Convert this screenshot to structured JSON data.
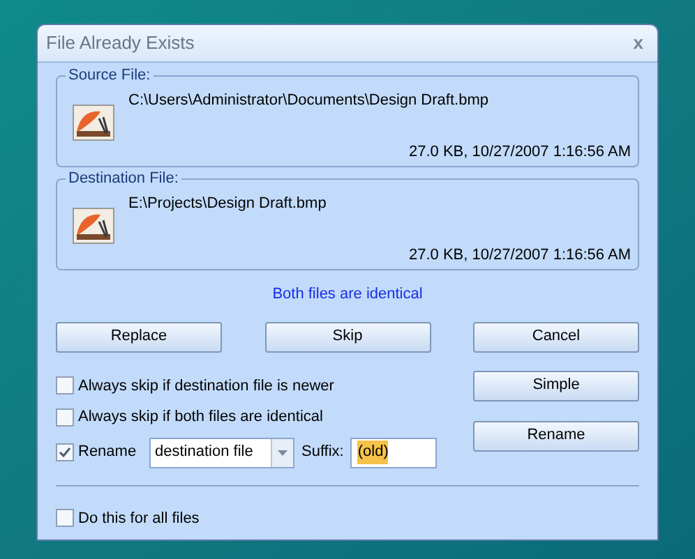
{
  "window": {
    "title": "File Already Exists",
    "close": "x"
  },
  "files": [
    {
      "legend": "Source File:",
      "path": "C:\\Users\\Administrator\\Documents\\Design Draft.bmp",
      "info": "27.0 KB, 10/27/2007 1:16:56 AM"
    },
    {
      "legend": "Destination File:",
      "path": "E:\\Projects\\Design Draft.bmp",
      "info": "27.0 KB, 10/27/2007 1:16:56 AM"
    }
  ],
  "status": "Both files are identical",
  "buttons": [
    "Replace",
    "Skip",
    "Cancel"
  ],
  "options": [
    {
      "label": "Always skip if destination file is newer",
      "checked": false
    },
    {
      "label": "Always skip if both files are identical",
      "checked": false
    }
  ],
  "rename": {
    "label": "Rename",
    "checked": true,
    "target": "destination file",
    "suffix_label": "Suffix:",
    "suffix": "(old)"
  },
  "side_buttons": [
    "Simple",
    "Rename"
  ],
  "all_files": {
    "label": "Do this for all files",
    "checked": false
  }
}
